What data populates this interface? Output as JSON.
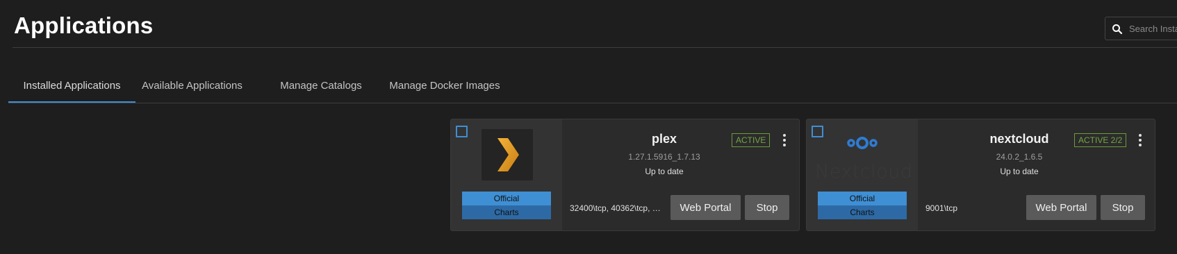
{
  "page": {
    "title": "Applications"
  },
  "search": {
    "placeholder": "Search Insta",
    "icon": "search-icon"
  },
  "tabs": [
    {
      "label": "Installed Applications",
      "active": true
    },
    {
      "label": "Available Applications",
      "active": false
    },
    {
      "label": "Manage Catalogs",
      "active": false
    },
    {
      "label": "Manage Docker Images",
      "active": false
    }
  ],
  "apps": [
    {
      "name": "plex",
      "version": "1.27.1.5916_1.7.13",
      "update_status": "Up to date",
      "state": "ACTIVE",
      "train_line1": "Official",
      "train_line2": "Charts",
      "ports": "32400\\tcp, 40362\\tcp, …",
      "web_portal_label": "Web Portal",
      "stop_label": "Stop",
      "logo": "plex-logo"
    },
    {
      "name": "nextcloud",
      "version": "24.0.2_1.6.5",
      "update_status": "Up to date",
      "state": "ACTIVE 2/2",
      "train_line1": "Official",
      "train_line2": "Charts",
      "ports": "9001\\tcp",
      "web_portal_label": "Web Portal",
      "stop_label": "Stop",
      "logo": "nextcloud-logo",
      "logo_text": "Nextcloud"
    }
  ],
  "colors": {
    "accent": "#3f8fd4",
    "active_state": "#76a544",
    "background": "#1e1e1e",
    "card": "#2b2b2b",
    "button": "#5a5a5a"
  }
}
